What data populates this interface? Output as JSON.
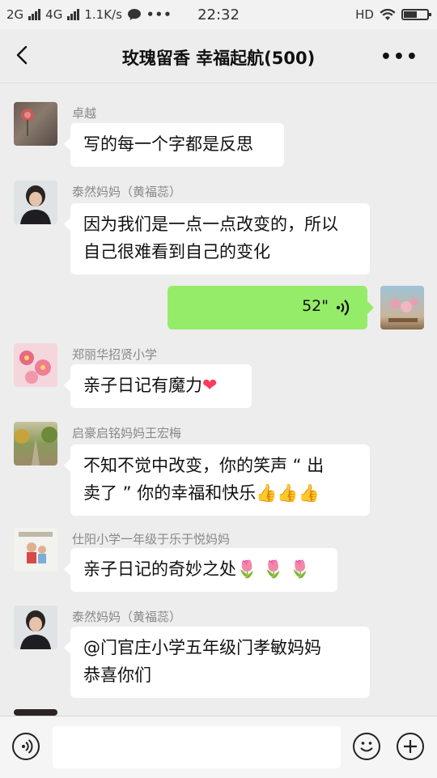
{
  "status_bar": {
    "network1": "2G",
    "network2": "4G",
    "speed": "1.1K/s",
    "time": "22:32",
    "hd": "HD"
  },
  "header": {
    "title": "玫瑰留香  幸福起航(500)"
  },
  "messages": [
    {
      "sender": "卓越",
      "lines": [
        "写的每一个字都是反思"
      ]
    },
    {
      "sender": "泰然妈妈（黄福蕊）",
      "lines": [
        "因为我们是一点一点改变的，所以",
        "自己很难看到自己的变化"
      ]
    },
    {
      "voice_duration": "52\""
    },
    {
      "sender": "郑丽华招贤小学",
      "lines": [
        "亲子日记有魔力"
      ],
      "emoji": "❤"
    },
    {
      "sender": "启豪启铭妈妈王宏梅",
      "lines": [
        "不知不觉中改变，你的笑声 “ 出",
        "卖了 ” 你的幸福和快乐"
      ],
      "emoji": "👍👍👍"
    },
    {
      "sender": "仕阳小学一年级于乐于悦妈妈",
      "lines": [
        "亲子日记的奇妙之处"
      ],
      "emoji": "🌷 🌷 🌷"
    },
    {
      "sender": "泰然妈妈（黄福蕊）",
      "lines": [
        "@门官庄小学五年级门孝敏妈妈",
        "恭喜你们"
      ]
    }
  ],
  "colors": {
    "background": "#ededed",
    "voice_bubble": "#95ec69"
  }
}
